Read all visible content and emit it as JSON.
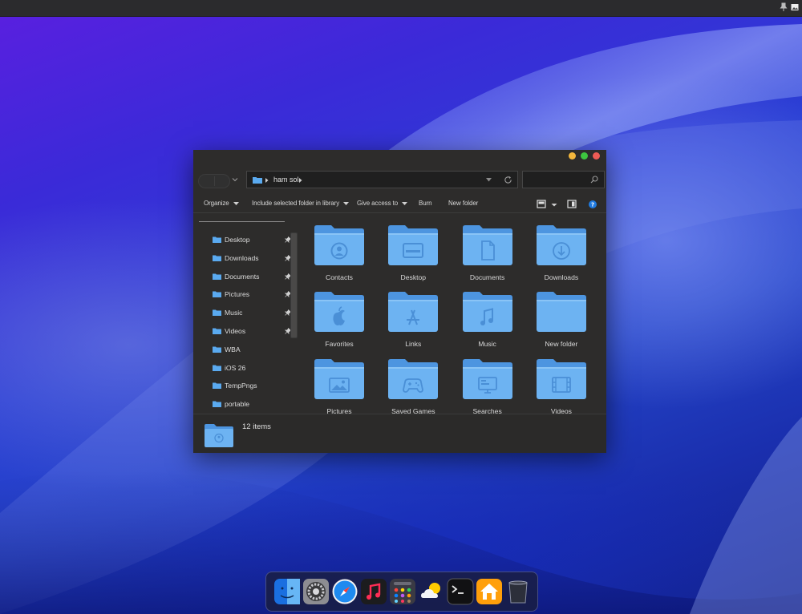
{
  "window": {
    "address_path": "ham sol",
    "search_placeholder": "",
    "toolbar": {
      "organize": "Organize",
      "include_library": "Include selected folder in library",
      "give_access": "Give access to",
      "burn": "Burn",
      "new_folder": "New folder"
    },
    "sidebar": {
      "items": [
        {
          "label": "Desktop",
          "pinned": true
        },
        {
          "label": "Downloads",
          "pinned": true
        },
        {
          "label": "Documents",
          "pinned": true
        },
        {
          "label": "Pictures",
          "pinned": true
        },
        {
          "label": "Music",
          "pinned": true
        },
        {
          "label": "Videos",
          "pinned": true
        },
        {
          "label": "WBA",
          "pinned": false
        },
        {
          "label": "iOS 26",
          "pinned": false
        },
        {
          "label": "TempPngs",
          "pinned": false
        },
        {
          "label": "portable",
          "pinned": false
        }
      ]
    },
    "folders": [
      {
        "label": "Contacts",
        "glyph": "contact-icon"
      },
      {
        "label": "Desktop",
        "glyph": "desktop-icon"
      },
      {
        "label": "Documents",
        "glyph": "document-icon"
      },
      {
        "label": "Downloads",
        "glyph": "download-icon"
      },
      {
        "label": "Favorites",
        "glyph": "apple-icon"
      },
      {
        "label": "Links",
        "glyph": "app-store-icon"
      },
      {
        "label": "Music",
        "glyph": "music-note-icon"
      },
      {
        "label": "New folder",
        "glyph": "none"
      },
      {
        "label": "Pictures",
        "glyph": "picture-icon"
      },
      {
        "label": "Saved Games",
        "glyph": "gamepad-icon"
      },
      {
        "label": "Searches",
        "glyph": "monitor-icon"
      },
      {
        "label": "Videos",
        "glyph": "film-icon"
      }
    ],
    "status": {
      "item_count": "12 items"
    }
  },
  "dock": {
    "apps": [
      "finder-icon",
      "settings-icon",
      "safari-icon",
      "music-icon",
      "launchpad-icon",
      "weather-icon",
      "terminal-icon",
      "home-icon",
      "trash-icon"
    ]
  },
  "colors": {
    "folder_front": "#6db3f2",
    "folder_back": "#4d95e0",
    "folder_glyph": "#4a8fd6",
    "window_bg": "#2d2c2b",
    "traffic_yellow": "#f4b73c",
    "traffic_green": "#3dc53f",
    "traffic_red": "#ee5b55",
    "help_blue": "#1f7ae0"
  }
}
